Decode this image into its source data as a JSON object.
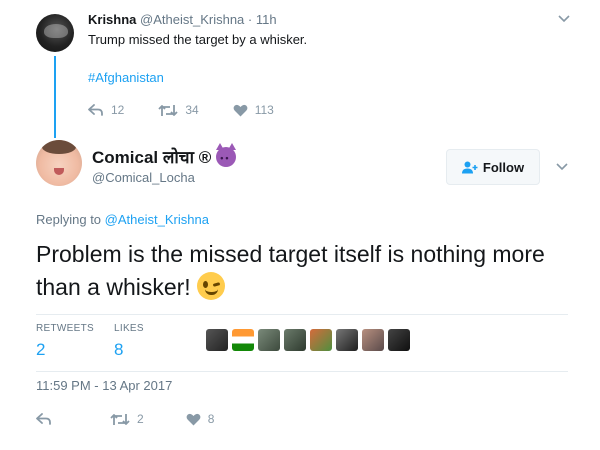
{
  "parent_tweet": {
    "name": "Krishna",
    "handle": "@Atheist_Krishna",
    "separator": "·",
    "time": "11h",
    "text": "Trump missed the target by a whisker.",
    "hashtag": "#Afghanistan",
    "reply_icon": "reply-icon",
    "retweet_icon": "retweet-icon",
    "like_icon": "heart-icon",
    "replies": "12",
    "retweets": "34",
    "likes": "113"
  },
  "main_tweet": {
    "name": "Comical लोचा ®",
    "handle": "@Comical_Locha",
    "follow_label": "Follow",
    "replying_prefix": "Replying to",
    "replying_handle": "@Atheist_Krishna",
    "text": "Problem is the missed target itself is nothing more than a whisker!",
    "retweets_label": "RETWEETS",
    "retweets_count": "2",
    "likes_label": "LIKES",
    "likes_count": "8",
    "timestamp": "11:59 PM - 13 Apr 2017",
    "retweet_action_count": "2",
    "like_action_count": "8"
  },
  "colors": {
    "accent": "#1da1f2",
    "muted": "#657786",
    "text": "#14171a"
  }
}
